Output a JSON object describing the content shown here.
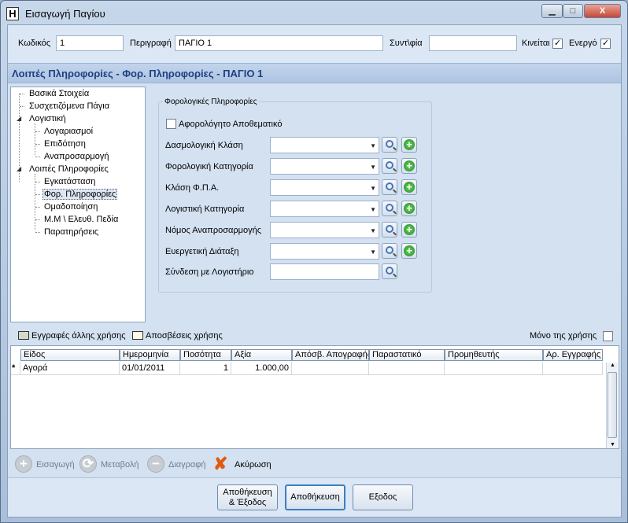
{
  "window": {
    "title": "Εισαγωγή Παγίου",
    "app_icon": "Η",
    "minimize": "▁",
    "maximize": "□",
    "close": "X"
  },
  "header": {
    "code_label": "Κωδικός",
    "code_value": "1",
    "desc_label": "Περιγραφή",
    "desc_value": "ΠΑΓΙΟ 1",
    "coef_label": "Συντ\\φία",
    "coef_value": "",
    "moving_label": "Κινείται",
    "moving_checked": true,
    "active_label": "Ενεργό",
    "active_checked": true
  },
  "breadcrumb": "Λοιπές Πληροφορίες - Φορ. Πληροφορίες - ΠΑΓΙΟ 1",
  "tree": {
    "items": [
      {
        "label": "Βασικά Στοιχεία"
      },
      {
        "label": "Συσχετιζόμενα Πάγια"
      },
      {
        "label": "Λογιστική"
      },
      {
        "label": "Λογαριασμοί"
      },
      {
        "label": "Επιδότηση"
      },
      {
        "label": "Αναπροσαρμογή"
      },
      {
        "label": "Λοιπές Πληροφορίες"
      },
      {
        "label": "Εγκατάσταση"
      },
      {
        "label": "Φορ. Πληροφορίες"
      },
      {
        "label": "Ομαδοποίηση"
      },
      {
        "label": "Μ.Μ \\ Ελευθ. Πεδία"
      },
      {
        "label": "Παρατηρήσεις"
      }
    ],
    "selected": "Φορ. Πληροφορίες"
  },
  "tax_group": {
    "title": "Φορολογικές Πληροφορίες",
    "tax_free_label": "Αφορολόγητο Αποθεματικό",
    "tax_free_checked": false,
    "fields": [
      {
        "label": "Δασμολογική Κλάση",
        "value": ""
      },
      {
        "label": "Φορολογική Κατηγορία",
        "value": ""
      },
      {
        "label": "Κλάση Φ.Π.Α.",
        "value": ""
      },
      {
        "label": "Λογιστική Κατηγορία",
        "value": ""
      },
      {
        "label": "Νόμος Αναπροσαρμογής",
        "value": ""
      },
      {
        "label": "Ευεργετική Διάταξη",
        "value": ""
      }
    ],
    "ledger_link_label": "Σύνδεση με Λογιστήριο",
    "ledger_link_value": ""
  },
  "options": {
    "other_year_label": "Εγγραφές άλλης χρήσης",
    "depr_label": "Αποσβέσεις χρήσης",
    "only_year_label": "Μόνο της χρήσης",
    "only_year_checked": false,
    "other_year_color": "#d5d9c9",
    "depr_color": "#fdfbe2"
  },
  "grid": {
    "columns": [
      "Είδος",
      "Ημερομηνία",
      "Ποσότητα",
      "Αξία",
      "Απόσβ. Απογραφής",
      "Παραστατικό",
      "Προμηθευτής",
      "Αρ. Εγγραφής"
    ],
    "rows": [
      {
        "marker": "*",
        "cells": [
          "Αγορά",
          "01/01/2011",
          "1",
          "1.000,00",
          "",
          "",
          "",
          ""
        ]
      }
    ]
  },
  "toolbar": {
    "insert": "Εισαγωγή",
    "modify": "Μεταβολή",
    "delete": "Διαγραφή",
    "cancel": "Ακύρωση"
  },
  "footer": {
    "save_exit_1": "Αποθήκευση",
    "save_exit_2": "& Έξοδος",
    "save": "Αποθήκευση",
    "exit": "Εξοδος"
  }
}
